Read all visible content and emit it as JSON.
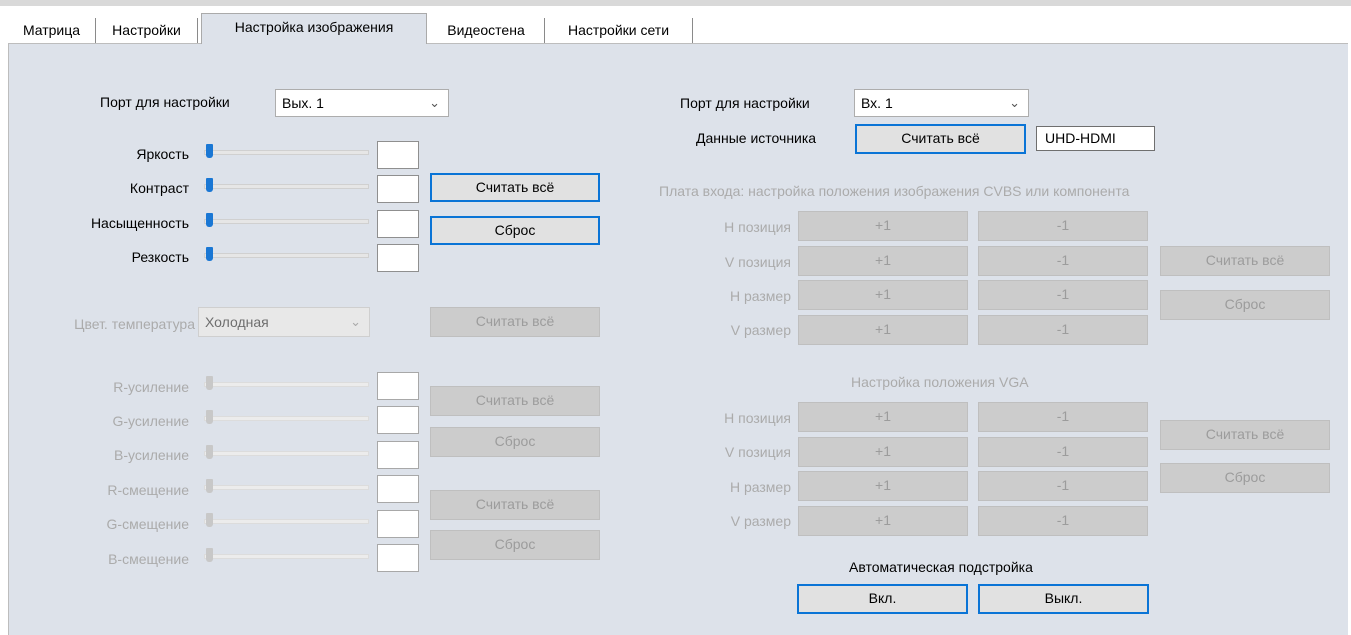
{
  "tabs": [
    "Матрица",
    "Настройки",
    "Настройка изображения",
    "Видеостена",
    "Настройки сети"
  ],
  "left": {
    "port_label": "Порт для настройки",
    "port_value": "Вых. 1",
    "sliders": [
      {
        "label": "Яркость",
        "value": 0
      },
      {
        "label": "Контраст",
        "value": 0
      },
      {
        "label": "Насыщенность",
        "value": 0
      },
      {
        "label": "Резкость",
        "value": 0
      }
    ],
    "read_all": "Считать всё",
    "reset": "Сброс",
    "color_temp_label": "Цвет. температура",
    "color_temp_value": "Холодная",
    "color_temp_read": "Считать всё",
    "gain_sliders": [
      {
        "label": "R-усиление",
        "value": 0
      },
      {
        "label": "G-усиление",
        "value": 0
      },
      {
        "label": "B-усиление",
        "value": 0
      }
    ],
    "offset_sliders": [
      {
        "label": "R-смещение",
        "value": 0
      },
      {
        "label": "G-смещение",
        "value": 0
      },
      {
        "label": "B-смещение",
        "value": 0
      }
    ],
    "gain_read": "Считать всё",
    "gain_reset": "Сброс",
    "offset_read": "Считать всё",
    "offset_reset": "Сброс"
  },
  "right": {
    "port_label": "Порт для настройки",
    "port_value": "Вх. 1",
    "source_label": "Данные источника",
    "source_read": "Считать всё",
    "source_value": "UHD-HDMI",
    "cvbs_title": "Плата входа: настройка положения изображения CVBS или компонента",
    "cvbs_rows": [
      {
        "label": "H позиция",
        "plus": "+1",
        "minus": "-1"
      },
      {
        "label": "V позиция",
        "plus": "+1",
        "minus": "-1"
      },
      {
        "label": "H размер",
        "plus": "+1",
        "minus": "-1"
      },
      {
        "label": "V размер",
        "plus": "+1",
        "minus": "-1"
      }
    ],
    "cvbs_read": "Считать всё",
    "cvbs_reset": "Сброс",
    "vga_title": "Настройка положения VGA",
    "vga_rows": [
      {
        "label": "H позиция",
        "plus": "+1",
        "minus": "-1"
      },
      {
        "label": "V позиция",
        "plus": "+1",
        "minus": "-1"
      },
      {
        "label": "H размер",
        "plus": "+1",
        "minus": "-1"
      },
      {
        "label": "V размер",
        "plus": "+1",
        "minus": "-1"
      }
    ],
    "vga_read": "Считать всё",
    "vga_reset": "Сброс",
    "auto_title": "Автоматическая подстройка",
    "auto_on": "Вкл.",
    "auto_off": "Выкл."
  }
}
